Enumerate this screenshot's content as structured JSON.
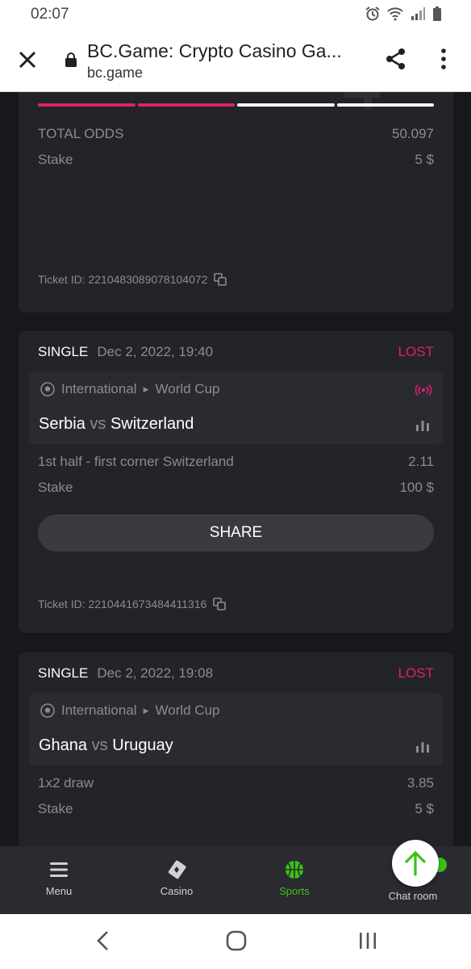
{
  "status": {
    "time": "02:07"
  },
  "browser": {
    "title": "BC.Game: Crypto Casino Ga...",
    "url": "bc.game"
  },
  "card1": {
    "total_odds_label": "TOTAL ODDS",
    "total_odds_value": "50.097",
    "stake_label": "Stake",
    "stake_value": "5 $",
    "ticket": "Ticket ID: 2210483089078104072",
    "progress_colors": [
      "#e0206e",
      "#e0206e",
      "#ffffff",
      "#ffffff"
    ]
  },
  "card2": {
    "type": "SINGLE",
    "date": "Dec 2, 2022, 19:40",
    "status": "LOST",
    "league_region": "International",
    "league_name": "World Cup",
    "home": "Serbia",
    "vs": "vs",
    "away": "Switzerland",
    "market": "1st half - first corner Switzerland",
    "odds": "2.11",
    "stake_label": "Stake",
    "stake_value": "100 $",
    "share_label": "SHARE",
    "ticket": "Ticket ID: 2210441673484411316"
  },
  "card3": {
    "type": "SINGLE",
    "date": "Dec 2, 2022, 19:08",
    "status": "LOST",
    "league_region": "International",
    "league_name": "World Cup",
    "home": "Ghana",
    "vs": "vs",
    "away": "Uruguay",
    "market": "1x2 draw",
    "odds": "3.85",
    "stake_label": "Stake",
    "stake_value": "5 $"
  },
  "nav": {
    "menu": "Menu",
    "casino": "Casino",
    "sports": "Sports",
    "chat": "Chat room"
  },
  "colors": {
    "accent_green": "#3bc117",
    "lost_pink": "#e0206e"
  }
}
